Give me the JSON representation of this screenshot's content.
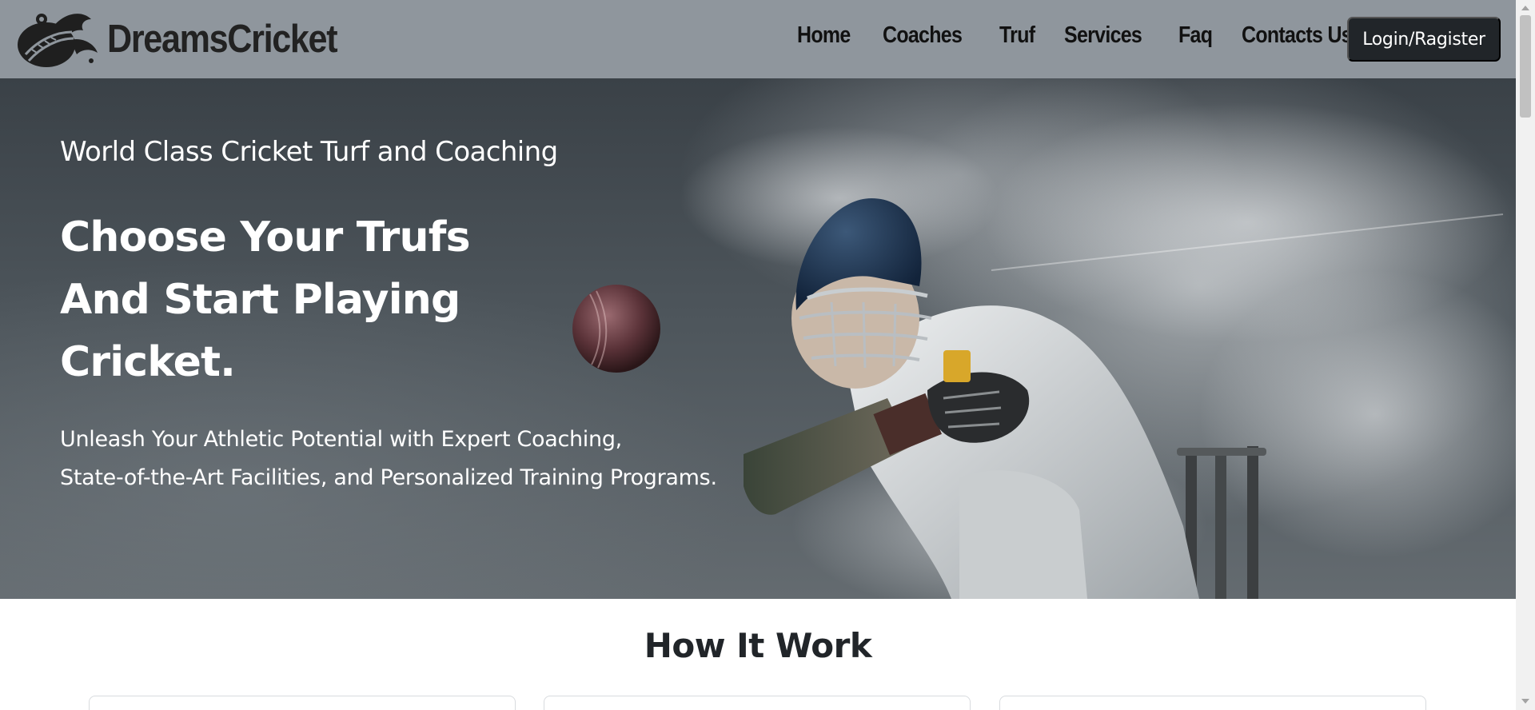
{
  "brand": {
    "name": "DreamsCricket",
    "logo_icon": "cricket-ball-logo-icon"
  },
  "nav": {
    "items": [
      {
        "label": "Home"
      },
      {
        "label": "Coaches"
      },
      {
        "label": "Truf"
      },
      {
        "label": "Services"
      },
      {
        "label": "Faq"
      },
      {
        "label": "Contacts Us"
      }
    ],
    "login_label": "Login/Ragister"
  },
  "hero": {
    "kicker": "World Class Cricket Turf and Coaching",
    "title_lines": [
      "Choose Your Trufs",
      "And Start Playing",
      "Cricket."
    ],
    "description_lines": [
      "Unleash Your Athletic Potential with Expert Coaching,",
      "State-of-the-Art Facilities, and Personalized Training Programs."
    ]
  },
  "section": {
    "title": "How It Work"
  },
  "colors": {
    "header_bg": "#8f969d",
    "login_bg": "#212529",
    "hero_text": "#ffffff"
  }
}
